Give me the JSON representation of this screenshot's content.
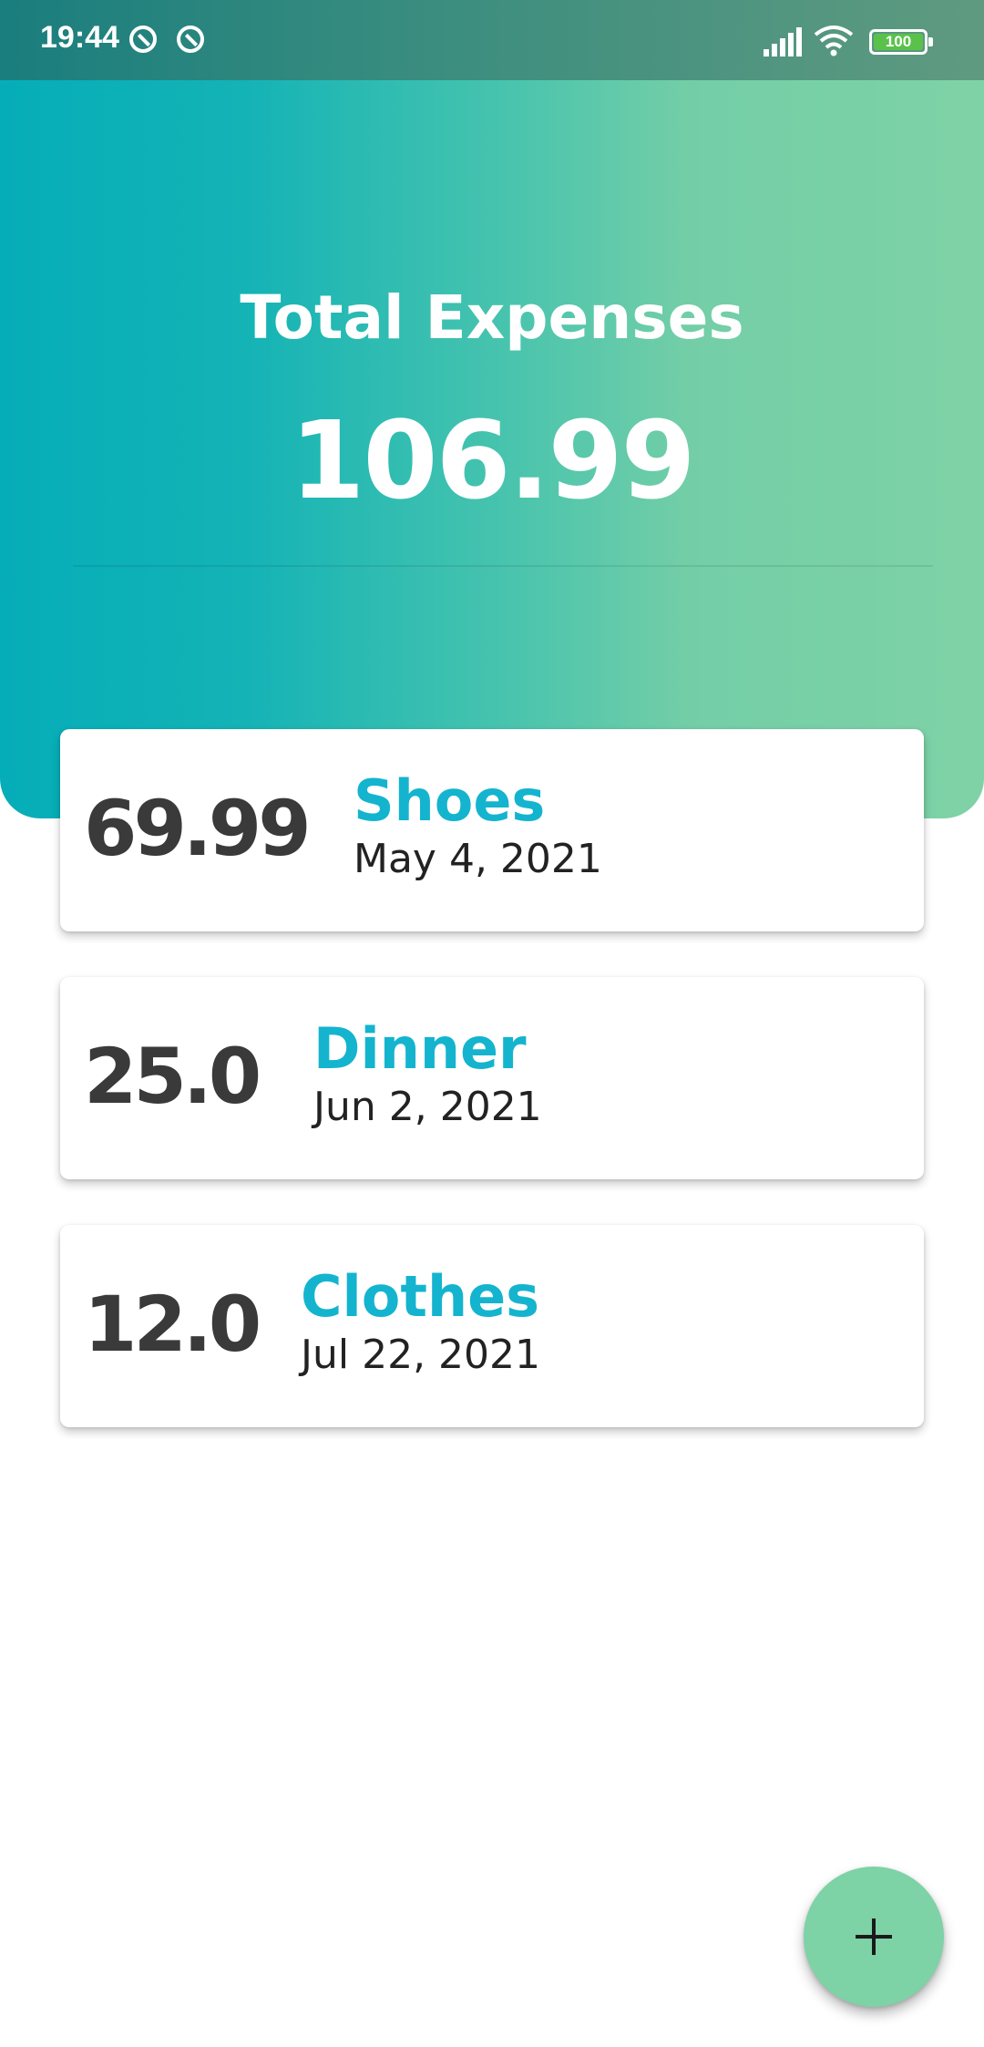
{
  "status_bar": {
    "time": "19:44",
    "battery_level": "100",
    "icons": [
      "app-notification-icon",
      "app-notification-icon",
      "signal-icon",
      "wifi-icon",
      "battery-icon"
    ]
  },
  "header": {
    "title": "Total Expenses",
    "total": "106.99"
  },
  "expenses": [
    {
      "amount": "69.99",
      "title": "Shoes",
      "date": "May 4, 2021"
    },
    {
      "amount": "25.0",
      "title": "Dinner",
      "date": "Jun 2, 2021"
    },
    {
      "amount": "12.0",
      "title": "Clothes",
      "date": "Jul 22, 2021"
    }
  ],
  "fab": {
    "icon": "plus-icon"
  },
  "colors": {
    "gradient_start": "#05adb8",
    "gradient_end": "#7fd2a6",
    "accent": "#14b4cf",
    "amount_text": "#3a3a3a",
    "fab": "#7dd2a6"
  }
}
